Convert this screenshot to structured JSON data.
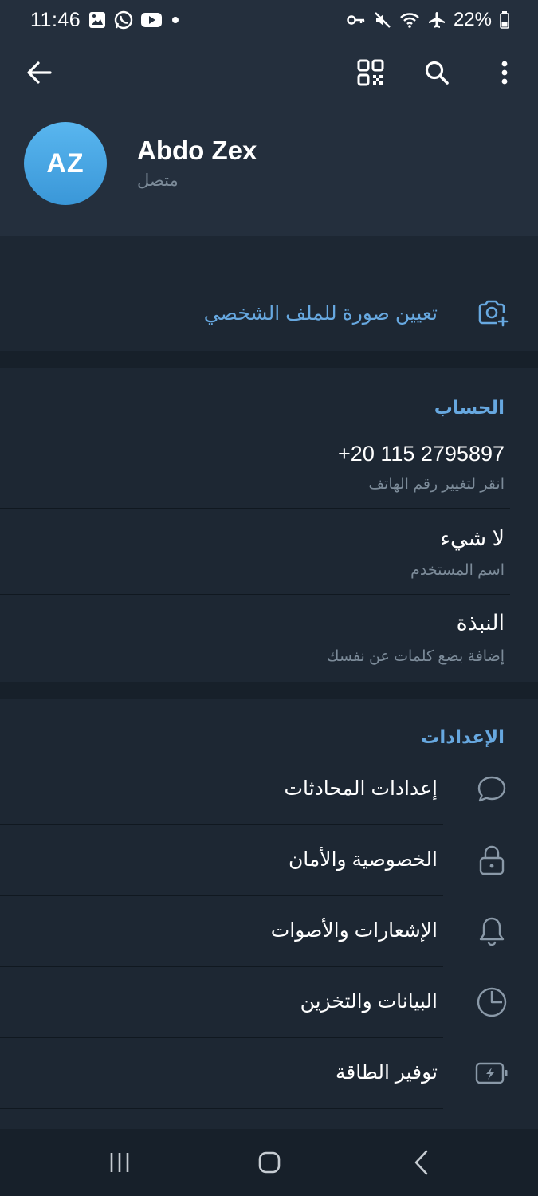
{
  "status_bar": {
    "time": "11:46",
    "battery": "22%",
    "left_icons": [
      "gallery-icon",
      "whatsapp-icon",
      "youtube-icon",
      "dot-icon"
    ],
    "right_icons": [
      "vpn-key-icon",
      "mute-icon",
      "wifi-icon",
      "airplane-icon",
      "battery-icon"
    ]
  },
  "toolbar": {
    "back_icon": "arrow-left-icon",
    "qr_icon": "qr-code-icon",
    "search_icon": "search-icon",
    "more_icon": "more-vertical-icon"
  },
  "profile": {
    "initials": "AZ",
    "name": "Abdo Zex",
    "status": "متصل"
  },
  "set_photo": {
    "label": "تعيين صورة للملف الشخصي",
    "icon": "camera-add-icon"
  },
  "account": {
    "title": "الحساب",
    "rows": [
      {
        "main": "+20 115 2795897",
        "sub": "انقر لتغيير رقم الهاتف"
      },
      {
        "main": "لا شيء",
        "sub": "اسم المستخدم"
      },
      {
        "main": "النبذة",
        "sub": "إضافة بضع كلمات عن نفسك"
      }
    ]
  },
  "settings": {
    "title": "الإعدادات",
    "items": [
      {
        "label": "إعدادات المحادثات",
        "icon": "chat-bubble-icon"
      },
      {
        "label": "الخصوصية والأمان",
        "icon": "lock-icon"
      },
      {
        "label": "الإشعارات والأصوات",
        "icon": "bell-icon"
      },
      {
        "label": "البيانات والتخزين",
        "icon": "pie-chart-icon"
      },
      {
        "label": "توفير الطاقة",
        "icon": "battery-charging-icon"
      }
    ]
  },
  "nav_bar": {
    "recents_icon": "recents-icon",
    "home_icon": "home-icon",
    "back_icon": "nav-back-icon"
  },
  "colors": {
    "accent": "#67a8e0",
    "background": "#1d2733",
    "header": "#242f3d",
    "secondary_text": "#7c8b99"
  }
}
